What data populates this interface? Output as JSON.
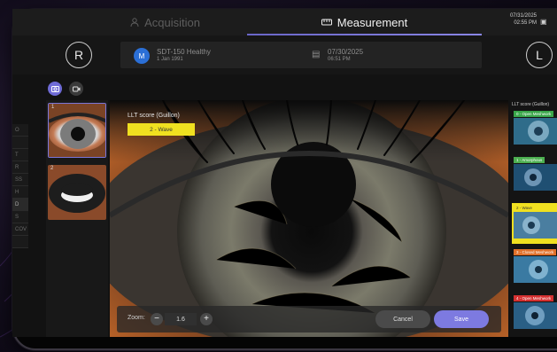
{
  "top_nav": {
    "acquisition_tab": "Acquisition",
    "measurement_tab": "Measurement",
    "date": "07/31/2025",
    "time": "02:55 PM"
  },
  "patient": {
    "right_eye_label": "R",
    "left_eye_label": "L",
    "avatar_initial": "M",
    "name": "SDT-150 Healthy",
    "dob": "1 Jan 1991",
    "exam_date": "07/30/2025",
    "exam_time": "06:51 PM"
  },
  "modes": {
    "photo": "camera-icon",
    "video": "video-icon"
  },
  "left_strip": [
    "O",
    "",
    "T",
    "R",
    "SS",
    "H",
    "D",
    "S",
    "COV",
    ""
  ],
  "thumbnails": [
    {
      "number": "1",
      "selected": true
    },
    {
      "number": "2",
      "selected": false
    }
  ],
  "image": {
    "llt_label": "LLT score (Guillon)",
    "llt_value": "2 - Wave"
  },
  "toolbar": {
    "zoom_label": "Zoom:",
    "zoom_minus": "−",
    "zoom_value": "1.6",
    "zoom_plus": "+",
    "cancel_label": "Cancel",
    "save_label": "Save"
  },
  "reference": {
    "title": "LLT score (Guillon)",
    "items": [
      {
        "label": "0 - Open Meshwork",
        "color": "#3aa64a"
      },
      {
        "label": "1 - Amorphous",
        "color": "#4caf50"
      },
      {
        "label": "2 - Wave",
        "color": "#f0e020"
      },
      {
        "label": "3 - Closed Meshwork",
        "color": "#e0702a"
      },
      {
        "label": "4 - Open Meshwork",
        "color": "#d43030"
      }
    ]
  },
  "colors": {
    "accent": "#7d7ae0",
    "highlight": "#f0e020"
  }
}
